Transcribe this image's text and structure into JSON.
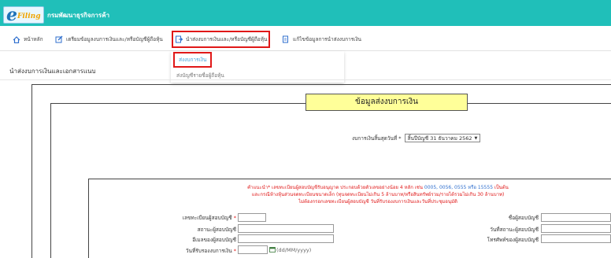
{
  "header": {
    "logo_e": "e",
    "logo_filing": "Filing",
    "department": "กรมพัฒนาธุรกิจการค้า",
    "bg_color": "#20bfb9"
  },
  "nav": {
    "items": [
      {
        "label": "หน้าหลัก",
        "icon": "home-icon"
      },
      {
        "label": "เตรียมข้อมูลงบการเงินและ/หรือบัญชีผู้ถือหุ้น",
        "icon": "edit-icon"
      },
      {
        "label": "นำส่งงบการเงินและ/หรือบัญชีผู้ถือหุ้น",
        "icon": "document-send-icon"
      },
      {
        "label": "แก้ไขข้อมูลการนำส่งงบการเงิน",
        "icon": "document-edit-icon"
      }
    ]
  },
  "dropdown": {
    "items": [
      "ส่งงบการเงิน",
      "ส่งบัญชีรายชื่อผู้ถือหุ้น"
    ]
  },
  "page": {
    "heading": "นำส่งงบการเงินและเอกสารแนบ"
  },
  "form": {
    "title": "ข้อมูลส่งงบการเงิน",
    "period_label": "งบการเงินสิ้นสุดวันที่ *",
    "period_value": "สิ้นปีบัญชี  31 ธันวาคม 2562",
    "warning_line1_a": "คำแนะนำ* เลขทะเบียนผู้สอบบัญชีรับอนุญาต ประกอบด้วยตัวเลขอย่างน้อย 4 หลัก เช่น ",
    "warning_line1_b": "0005, 0056, 0555 หรือ 15555",
    "warning_line1_c": " เป็นต้น",
    "warning_line2": "และกรณีห้างหุ้นส่วนจดทะเบียนขนาดเล็ก (ทุนจดทะเบียนไม่เกิน 5 ล้านบาท/หรือสินทรัพย์รวม/รายได้รวมไม่เกิน 30 ล้านบาท)",
    "warning_line3": "ไม่ต้องกรอกเลขทะเบียนผู้สอบบัญชี วันที่รับรองงบการเงินและวันที่ประชุมอนุมัติ",
    "fields_left": [
      {
        "label": "เลขทะเบียนผู้สอบบัญชี",
        "required": "*"
      },
      {
        "label": "สถานะผู้สอบบัญชี",
        "required": ""
      },
      {
        "label": "อีเมลของผู้สอบบัญชี",
        "required": ""
      },
      {
        "label": "วันที่รับรองงบการเงิน",
        "required": "*"
      }
    ],
    "fields_right": [
      {
        "label": "ชื่อผู้สอบบัญชี"
      },
      {
        "label": "วันที่สถานะผู้สอบบัญชี"
      },
      {
        "label": "โทรศัพท์ของผู้สอบบัญชี"
      }
    ],
    "date_hint": "(dd/MM/yyyy)"
  }
}
